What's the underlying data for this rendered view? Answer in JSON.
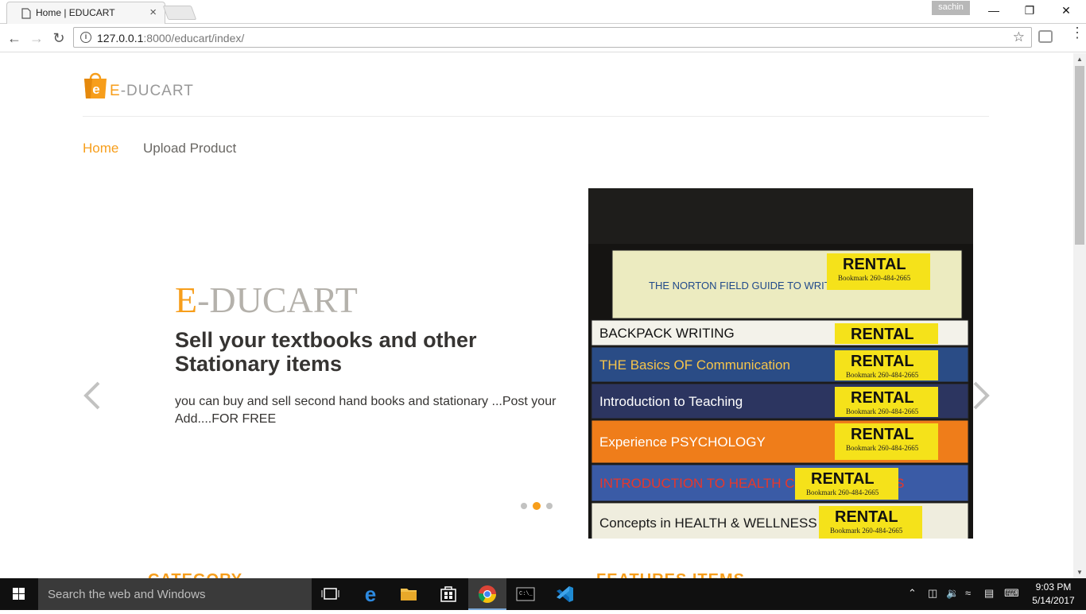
{
  "browser": {
    "tab_title": "Home | EDUCART",
    "tab_close": "×",
    "profile_name": "sachin",
    "url_host": "127.0.0.1",
    "url_path": ":8000/educart/index/"
  },
  "site": {
    "logo_text_prefix": "E",
    "logo_text_rest": "-DUCART",
    "nav": [
      {
        "label": "Home",
        "active": true
      },
      {
        "label": "Upload Product",
        "active": false
      }
    ],
    "hero": {
      "brand_prefix": "E",
      "brand_rest": "-DUCART",
      "heading": "Sell your textbooks and other Stationary items",
      "description": "you can buy and sell second hand books and stationary ...Post your Add....FOR FREE",
      "prev_arrow": "‹",
      "next_arrow": "›",
      "slide_count": 3,
      "active_slide": 2
    },
    "sections": {
      "category": "CATEGORY",
      "featured": "FEATURES ITEMS"
    },
    "books": [
      {
        "title": "THE NORTON FIELD GUIDE TO WRITING with READINGS",
        "label": "RENTAL"
      },
      {
        "title": "BACKPACK WRITING",
        "label": "RENTAL"
      },
      {
        "title": "THE Basics OF Communication",
        "label": "RENTAL"
      },
      {
        "title": "Introduction to Teaching",
        "label": "RENTAL"
      },
      {
        "title": "Experience PSYCHOLOGY",
        "label": "RENTAL"
      },
      {
        "title": "INTRODUCTION TO HEALTH CARE & CAREERS",
        "label": "RENTAL"
      },
      {
        "title": "Concepts in HEALTH & WELLNESS",
        "label": "RENTAL"
      }
    ],
    "sticker_subtext": "Bookmark 260-484-2665"
  },
  "taskbar": {
    "search_placeholder": "Search the web and Windows",
    "time": "9:03 PM",
    "date": "5/14/2017"
  },
  "colors": {
    "accent": "#f79e1b",
    "muted_text": "#696763",
    "taskbar": "#101010"
  }
}
